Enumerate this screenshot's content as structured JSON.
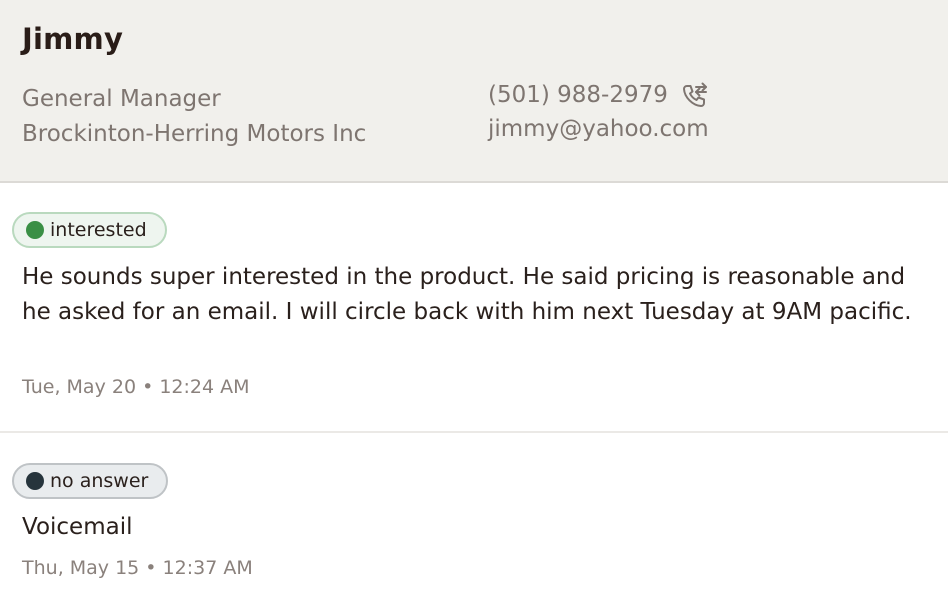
{
  "contact": {
    "name": "Jimmy",
    "title": "General Manager",
    "company": "Brockinton-Herring Motors Inc",
    "phone": "(501) 988-2979",
    "email": "jimmy@yahoo.com",
    "call_icon": "phone-outgoing-icon"
  },
  "notes": [
    {
      "status": "interested",
      "status_color": "#3a8f45",
      "text": "He sounds super interested in the product. He said pricing is reasonable and he asked for an email. I will circle back with him next Tuesday at 9AM pacific.",
      "timestamp": "Tue, May 20 • 12:24 AM"
    },
    {
      "status": "no answer",
      "status_color": "#26343c",
      "text": "Voicemail",
      "timestamp": "Thu, May 15 • 12:37 AM"
    }
  ]
}
